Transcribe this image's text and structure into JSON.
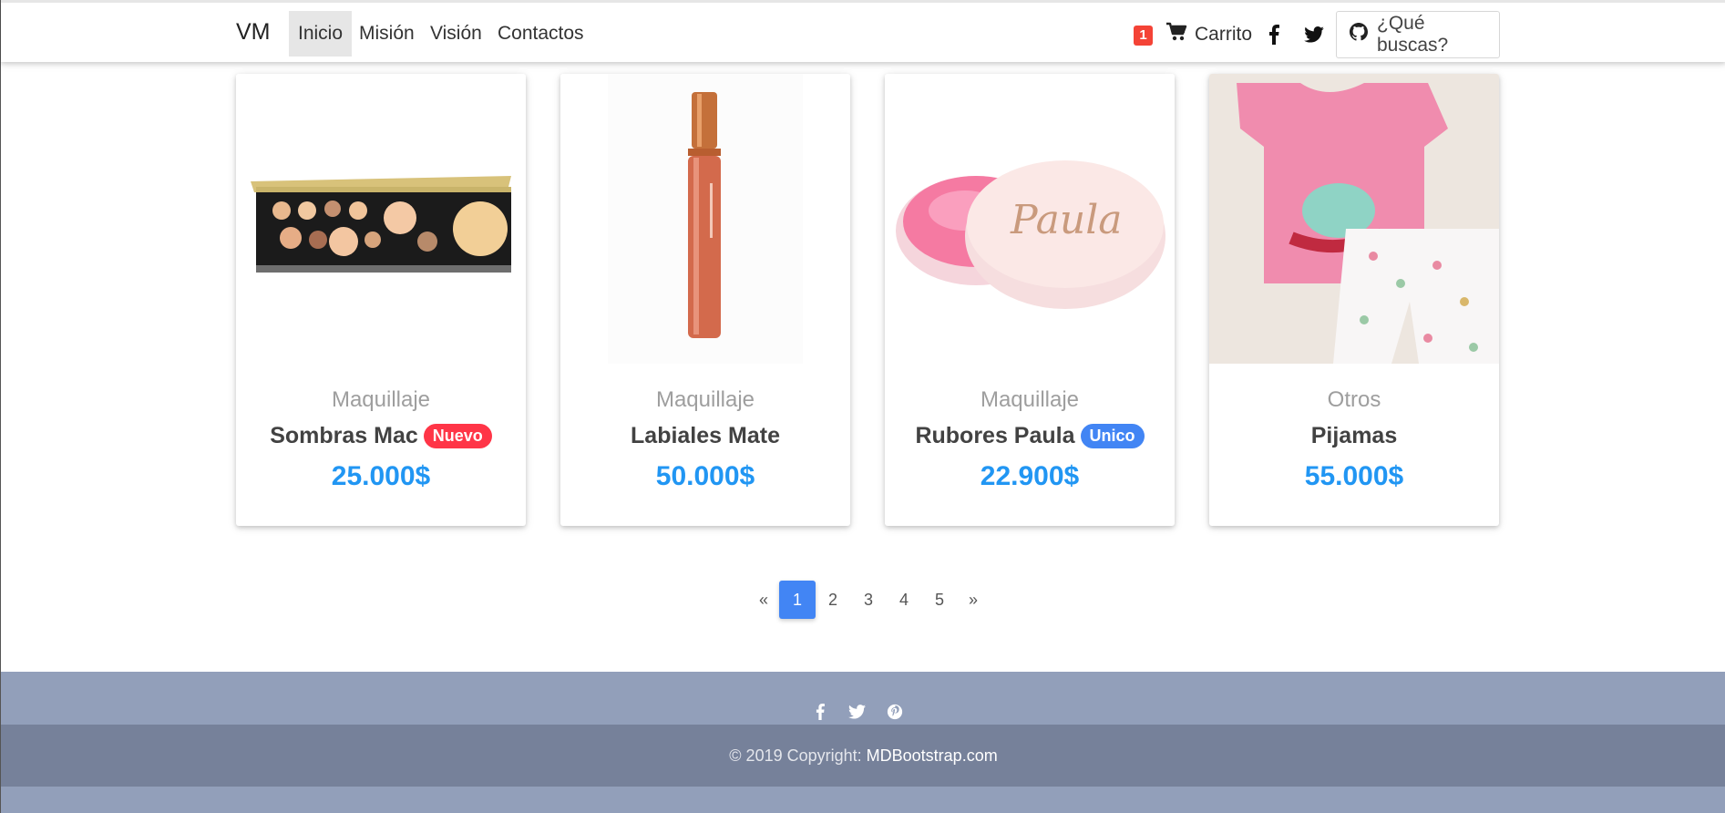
{
  "navbar": {
    "brand": "VM",
    "links": [
      "Inicio",
      "Misión",
      "Visión",
      "Contactos"
    ],
    "active": "Inicio",
    "cart_count": "1",
    "cart_label": "Carrito",
    "search_label": "¿Qué buscas?",
    "icons": [
      "facebook-icon",
      "twitter-icon",
      "github-icon",
      "shopping-cart-icon"
    ]
  },
  "products": [
    {
      "category": "Maquillaje",
      "name": "Sombras Mac",
      "badge": "Nuevo",
      "badge_color": "#ff3547",
      "price": "25.000$"
    },
    {
      "category": "Maquillaje",
      "name": "Labiales Mate",
      "badge": "",
      "price": "50.000$"
    },
    {
      "category": "Maquillaje",
      "name": "Rubores Paula",
      "badge": "Unico",
      "badge_color": "#4285f4",
      "price": "22.900$"
    },
    {
      "category": "Otros",
      "name": "Pijamas",
      "badge": "",
      "price": "55.000$"
    }
  ],
  "pagination": {
    "prev": "«",
    "pages": [
      "1",
      "2",
      "3",
      "4",
      "5"
    ],
    "next": "»",
    "current": "1"
  },
  "footer": {
    "copyright_prefix": "© 2019 Copyright: ",
    "copyright_link": "MDBootstrap.com",
    "social": [
      "facebook-icon",
      "twitter-icon",
      "pinterest-icon"
    ]
  },
  "colors": {
    "accent": "#4285f4",
    "price": "#2196f3",
    "footer_light": "#929fba",
    "footer_dark": "#76819a"
  }
}
